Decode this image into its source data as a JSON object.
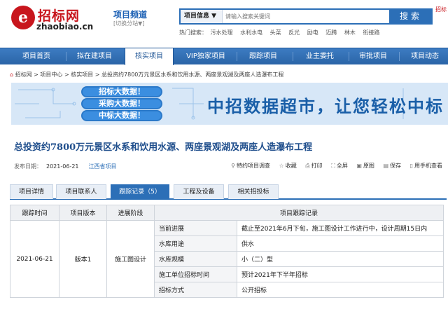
{
  "header": {
    "logo_mark": "e",
    "logo_cn": "招标网",
    "logo_en": "zhaobiao.cn",
    "channel": "项目频道",
    "channel_switch": "[切换分站▼]",
    "search_type": "项目信息 ▼",
    "search_placeholder": "请输入搜索关键词",
    "search_button": "搜索",
    "hot_label": "热门搜索：",
    "hot_keywords": [
      "污水处理",
      "水利水电",
      "头菜",
      "反光",
      "励电",
      "迈腾",
      "林木",
      "衔接路"
    ],
    "corner_text": "招标"
  },
  "nav": {
    "items": [
      "项目首页",
      "拟在建项目",
      "核实项目",
      "VIP独家项目",
      "跟踪项目",
      "业主委托",
      "审批项目",
      "项目动态"
    ],
    "active_index": 2
  },
  "breadcrumb": {
    "items": [
      "招标网",
      "项目中心",
      "核实项目",
      "总投资约7800万元景区水系和饮用水源、两座景观湖及两座人造瀑布工程"
    ],
    "separator": ">"
  },
  "banner": {
    "pills": [
      "招标大数据！",
      "采购大数据！",
      "中标大数据！"
    ],
    "headline": "中招数据超市，让您轻松中标"
  },
  "project": {
    "title": "总投资约7800万元景区水系和饮用水源、两座景观湖及两座人造瀑布工程",
    "publish_label": "发布日期：",
    "publish_date": "2021-06-21",
    "region": "江西省项目"
  },
  "actions": [
    "特约项目调查",
    "收藏",
    "打印",
    "全屏",
    "原图",
    "保存",
    "用手机查看"
  ],
  "tabs": {
    "items": [
      "项目详情",
      "项目联系人",
      "跟踪记录（5）",
      "工程及设备",
      "相关招投标"
    ],
    "active_index": 2
  },
  "table": {
    "headers": [
      "跟踪时间",
      "项目版本",
      "进展阶段",
      "项目跟踪记录"
    ],
    "date": "2021-06-21",
    "version": "版本1",
    "stage": "施工图设计",
    "records": [
      {
        "key": "当前进展",
        "value": "截止至2021年6月下旬，施工图设计工作进行中，设计周期15日内"
      },
      {
        "key": "水库用途",
        "value": "供水"
      },
      {
        "key": "水库规模",
        "value": "小（二）型"
      },
      {
        "key": "施工单位招标时间",
        "value": "预计2021年下半年招标"
      },
      {
        "key": "招标方式",
        "value": "公开招标"
      }
    ]
  }
}
